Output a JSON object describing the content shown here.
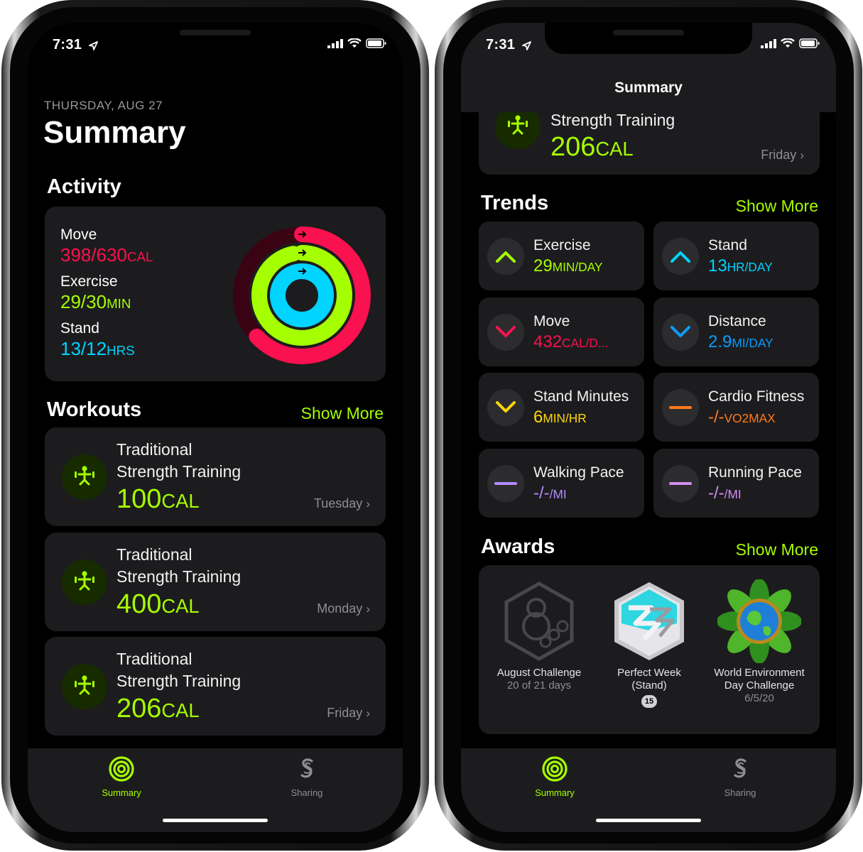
{
  "status": {
    "time": "7:31"
  },
  "left": {
    "date": "THURSDAY, AUG 27",
    "title": "Summary",
    "activity_title": "Activity",
    "rings": [
      {
        "label": "Move",
        "value": "398/630",
        "unit": "CAL",
        "progress": 0.632,
        "color": "#fa114f"
      },
      {
        "label": "Exercise",
        "value": "29/30",
        "unit": "MIN",
        "progress": 0.967,
        "color": "#a6ff00"
      },
      {
        "label": "Stand",
        "value": "13/12",
        "unit": "HRS",
        "progress": 1.083,
        "color": "#00d4ff"
      }
    ],
    "workouts_title": "Workouts",
    "show_more": "Show More",
    "workouts": [
      {
        "line1": "Traditional",
        "line2": "Strength Training",
        "cal": "100",
        "unit": "CAL",
        "day": "Tuesday"
      },
      {
        "line1": "Traditional",
        "line2": "Strength Training",
        "cal": "400",
        "unit": "CAL",
        "day": "Monday"
      },
      {
        "line1": "Traditional",
        "line2": "Strength Training",
        "cal": "206",
        "unit": "CAL",
        "day": "Friday"
      }
    ]
  },
  "right": {
    "nav_title": "Summary",
    "top_workout": {
      "title": "Strength Training",
      "cal": "206",
      "unit": "CAL",
      "day": "Friday"
    },
    "trends_title": "Trends",
    "show_more": "Show More",
    "trends": [
      {
        "name": "Exercise",
        "value": "29",
        "unit": "MIN/DAY",
        "direction": "up",
        "color": "#a6ff00"
      },
      {
        "name": "Stand",
        "value": "13",
        "unit": "HR/DAY",
        "direction": "up",
        "color": "#00d4ff"
      },
      {
        "name": "Move",
        "value": "432",
        "unit": "CAL/D...",
        "direction": "down",
        "color": "#fa114f"
      },
      {
        "name": "Distance",
        "value": "2.9",
        "unit": "MI/DAY",
        "direction": "down",
        "color": "#0a9cff"
      },
      {
        "name": "Stand Minutes",
        "value": "6",
        "unit": "MIN/HR",
        "direction": "down",
        "color": "#ffd60a"
      },
      {
        "name": "Cardio Fitness",
        "value": "-/-",
        "unit": "VO2MAX",
        "direction": "flat",
        "color": "#ff7a1a"
      },
      {
        "name": "Walking Pace",
        "value": "-/-",
        "unit": "/MI",
        "direction": "flat",
        "color": "#b18cff"
      },
      {
        "name": "Running Pace",
        "value": "-/-",
        "unit": "/MI",
        "direction": "flat",
        "color": "#d38cf2"
      }
    ],
    "awards_title": "Awards",
    "awards_show_more": "Show More",
    "awards": [
      {
        "name": "August Challenge",
        "sub": "20 of 21 days"
      },
      {
        "name": "Perfect Week",
        "sub": "(Stand)",
        "badge": "15"
      },
      {
        "name": "World Environment",
        "sub": "Day Challenge",
        "sub2": "6/5/20"
      }
    ]
  },
  "tabs": {
    "summary": "Summary",
    "sharing": "Sharing"
  }
}
